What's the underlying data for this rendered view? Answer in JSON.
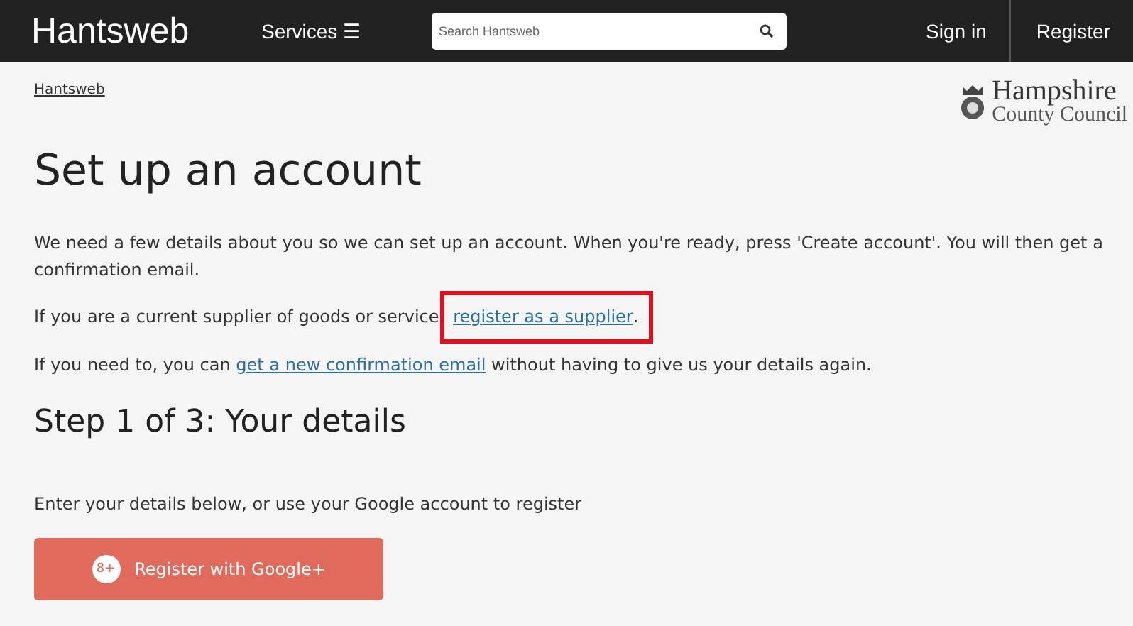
{
  "header": {
    "site_name": "Hantsweb",
    "services": "Services ☰",
    "search": {
      "placeholder": "Search Hantsweb"
    },
    "sign_in": "Sign in",
    "register": "Register"
  },
  "breadcrumb": "Hantsweb",
  "council_logo": {
    "line1": "Hampshire",
    "line2": "County Council"
  },
  "title": "Set up an account",
  "intro": "We need a few details about you so we can set up an account. When you're ready, press 'Create account'. You will then get a confirmation email.",
  "supplier": {
    "before": "If you are a current supplier of goods or service",
    "link": "register as a supplier",
    "after": ".",
    "highlighted": true
  },
  "confirmation": {
    "before": "If you need to, you can ",
    "link": "get a new confirmation email",
    "after": " without having to give us your details again."
  },
  "step_title": "Step 1 of 3: Your details",
  "step_text": "Enter your details below, or use your Google account to register",
  "google_button": {
    "icon_text": "8+",
    "label": "Register with Google+"
  }
}
